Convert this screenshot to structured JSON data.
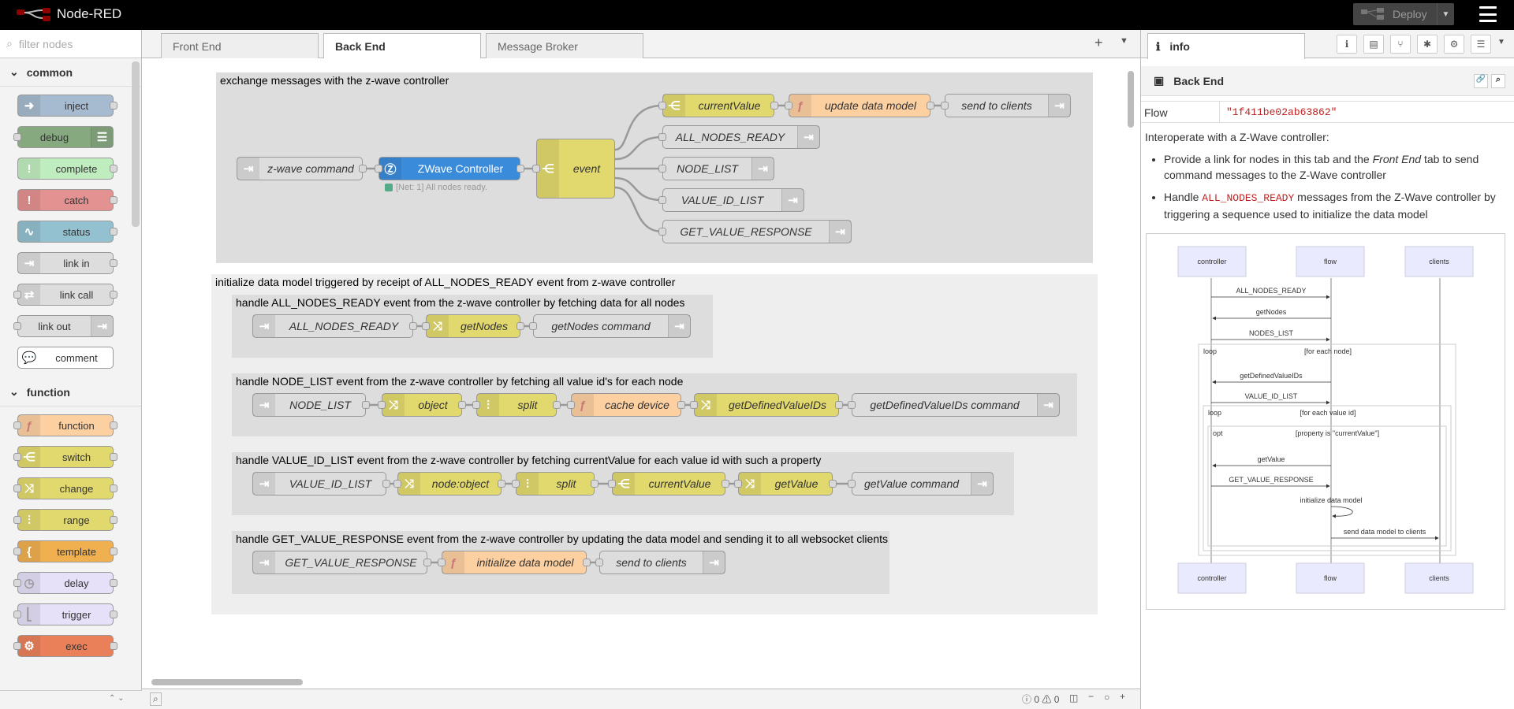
{
  "app": {
    "title": "Node-RED",
    "deploy_label": "Deploy"
  },
  "palette": {
    "filter_placeholder": "filter nodes",
    "categories": [
      {
        "name": "common",
        "nodes": [
          "inject",
          "debug",
          "complete",
          "catch",
          "status",
          "link in",
          "link call",
          "link out",
          "comment"
        ]
      },
      {
        "name": "function",
        "nodes": [
          "function",
          "switch",
          "change",
          "range",
          "template",
          "delay",
          "trigger",
          "exec"
        ]
      }
    ]
  },
  "tabs": [
    {
      "label": "Front End"
    },
    {
      "label": "Back End"
    },
    {
      "label": "Message Broker"
    }
  ],
  "workspace": {
    "groups": {
      "g1": "exchange messages with the z-wave controller",
      "g2": "initialize data model triggered by receipt of ALL_NODES_READY event from z-wave controller",
      "g3": "handle ALL_NODES_READY event from the z-wave controller by fetching data for all nodes",
      "g4": "handle NODE_LIST event from the z-wave controller by fetching all value id's for each node",
      "g5": "handle VALUE_ID_LIST event from the z-wave controller by fetching currentValue for each value id with such a property",
      "g6": "handle GET_VALUE_RESPONSE event from the z-wave controller by updating the data model and sending it to all websocket clients"
    },
    "nodes": {
      "zwave_command": "z-wave command",
      "zwave_controller": "ZWave Controller",
      "zwave_status": "[Net: 1] All nodes ready.",
      "event": "event",
      "currentValue": "currentValue",
      "update_data_model": "update data model",
      "send_to_clients": "send to clients",
      "all_nodes_ready": "ALL_NODES_READY",
      "node_list": "NODE_LIST",
      "value_id_list": "VALUE_ID_LIST",
      "get_value_response": "GET_VALUE_RESPONSE",
      "getNodes": "getNodes",
      "getNodes_command": "getNodes command",
      "object": "object",
      "split": "split",
      "cache_device": "cache device",
      "getDefinedValueIDs": "getDefinedValueIDs",
      "getDefinedValueIDs_command": "getDefinedValueIDs command",
      "node_object": "node:object",
      "getValue": "getValue",
      "getValue_command": "getValue command",
      "initialize_data_model": "initialize data model"
    }
  },
  "footer": {
    "errors": "0",
    "warnings": "0"
  },
  "sidebar": {
    "tab": "info",
    "heading": "Back End",
    "flow_key": "Flow",
    "flow_value": "\"1f411be02ab63862\"",
    "intro": "Interoperate with a Z-Wave controller:",
    "bullet1_a": "Provide a link for nodes in this tab and the ",
    "bullet1_em": "Front End",
    "bullet1_b": " tab to send command messages to the Z-Wave controller",
    "bullet2_a": "Handle ",
    "bullet2_code": "ALL_NODES_READY",
    "bullet2_b": " messages from the Z-Wave controller by triggering a sequence used to initialize the data model",
    "seq": {
      "participants": [
        "controller",
        "flow",
        "clients"
      ],
      "messages": [
        "ALL_NODES_READY",
        "getNodes",
        "NODES_LIST",
        "getDefinedValueIDs",
        "VALUE_ID_LIST",
        "getValue",
        "GET_VALUE_RESPONSE",
        "initialize data model",
        "send data model to clients"
      ],
      "loop1": "loop",
      "loop1_cond": "[for each node]",
      "loop2": "loop",
      "loop2_cond": "[for each value id]",
      "opt": "opt",
      "opt_cond": "[property is \"currentValue\"]"
    }
  }
}
